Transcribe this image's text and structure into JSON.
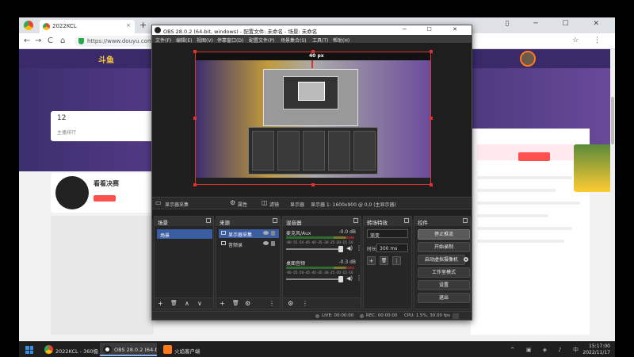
{
  "browser": {
    "tab_title": "2022KCL",
    "tab_close": "×",
    "new_tab": "+",
    "url": "https://www.douyu.com/9",
    "nav_back": "←",
    "nav_forward": "→",
    "nav_reload": "C",
    "nav_home": "⌂",
    "window_controls": "▯ ─ ☐ ✕",
    "nav_right": "☆ ⋮"
  },
  "site": {
    "logo": "斗鱼",
    "stat_count": "12",
    "stat_label": "主播排行",
    "streamer_name": "看看决赛"
  },
  "obs": {
    "title": "OBS 28.0.2 (64-bit, windows) - 配置文件: 未命名 - 场景: 未命名",
    "window_controls": "─ ☐ ✕",
    "menu": [
      "文件(F)",
      "编辑(E)",
      "视图(V)",
      "停靠窗口(D)",
      "配置文件(P)",
      "场景集合(S)",
      "工具(T)",
      "帮助(H)"
    ],
    "preview_badge": "40 px",
    "bar": {
      "source_label": "显示器采集",
      "properties": "属性",
      "filters": "滤镜",
      "display_label": "显示器",
      "display_value": "显示器 1: 1600x900 @ 0,0 (主显示器)"
    },
    "docks": {
      "scenes": {
        "title": "场景",
        "items": [
          "场景"
        ]
      },
      "sources": {
        "title": "来源",
        "items": [
          "显示器采集",
          "音频录"
        ]
      },
      "mixer": {
        "title": "混音器",
        "channels": [
          {
            "name": "麦克风/Aux",
            "db": "-0.0 dB"
          },
          {
            "name": "桌面音频",
            "db": "-0.3 dB"
          }
        ],
        "scale": "-60 -55 -50 -45 -40 -35 -30 -25 -20 -15 -10 -5 0"
      },
      "transitions": {
        "title": "转场特效",
        "type": "渐变",
        "duration_label": "时长",
        "duration": "300 ms"
      },
      "controls": {
        "title": "控件",
        "buttons": [
          "停止推流",
          "开始录制",
          "启动虚拟摄像机",
          "工作室模式",
          "设置",
          "退出"
        ]
      }
    },
    "footer_icons": {
      "add": "+",
      "remove": "🗑",
      "up": "∧",
      "down": "∨",
      "gear": "⚙",
      "more": "⋮"
    },
    "status": {
      "live": "LIVE: 00:00:00",
      "rec": "REC: 00:00:00",
      "cpu": "CPU: 1.5%, 30.00 fps"
    }
  },
  "taskbar": {
    "apps": [
      "2022KCL - 360极...",
      "OBS 28.0.2 (64-bi...",
      "火焰客户端"
    ],
    "tray": "^ ▣ ◈ ♪ 中",
    "time": "15:17:00",
    "date": "2022/11/17"
  },
  "colors": {
    "obs_bg": "#2b2b2b",
    "selection": "#3b5ea3",
    "preview_border": "#e03030"
  }
}
